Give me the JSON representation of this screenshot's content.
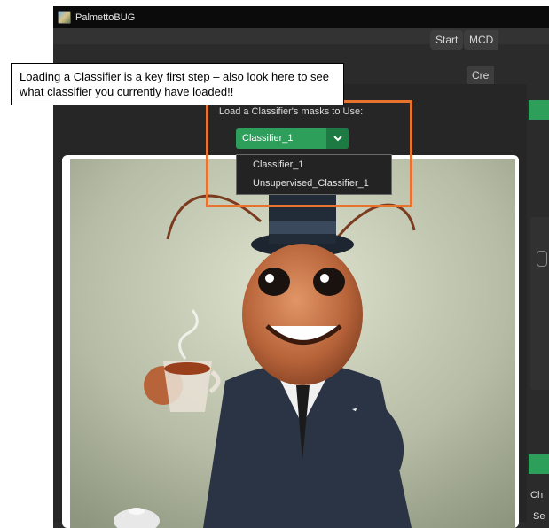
{
  "window": {
    "title": "PalmettoBUG"
  },
  "toolbar": {
    "start_label": "Start",
    "mcd_label": "MCD",
    "create_label": "Cre"
  },
  "classifier": {
    "prompt": "Load a Classifier's masks to Use:",
    "selected": "Classifier_1",
    "options": [
      "Classifier_1",
      "Unsupervised_Classifier_1"
    ]
  },
  "right_panel": {
    "label_ch": "Ch",
    "label_se": "Se"
  },
  "callout": {
    "text": "Loading a Classifier is a key first step – also look here to see what classifier you currently have loaded!!"
  },
  "colors": {
    "accent_green": "#2e9e5b",
    "highlight_orange": "#e8732e",
    "dark_bg": "#2b2b2b"
  },
  "icons": {
    "app": "palmettobug-app-icon",
    "dropdown": "chevron-down-icon"
  }
}
